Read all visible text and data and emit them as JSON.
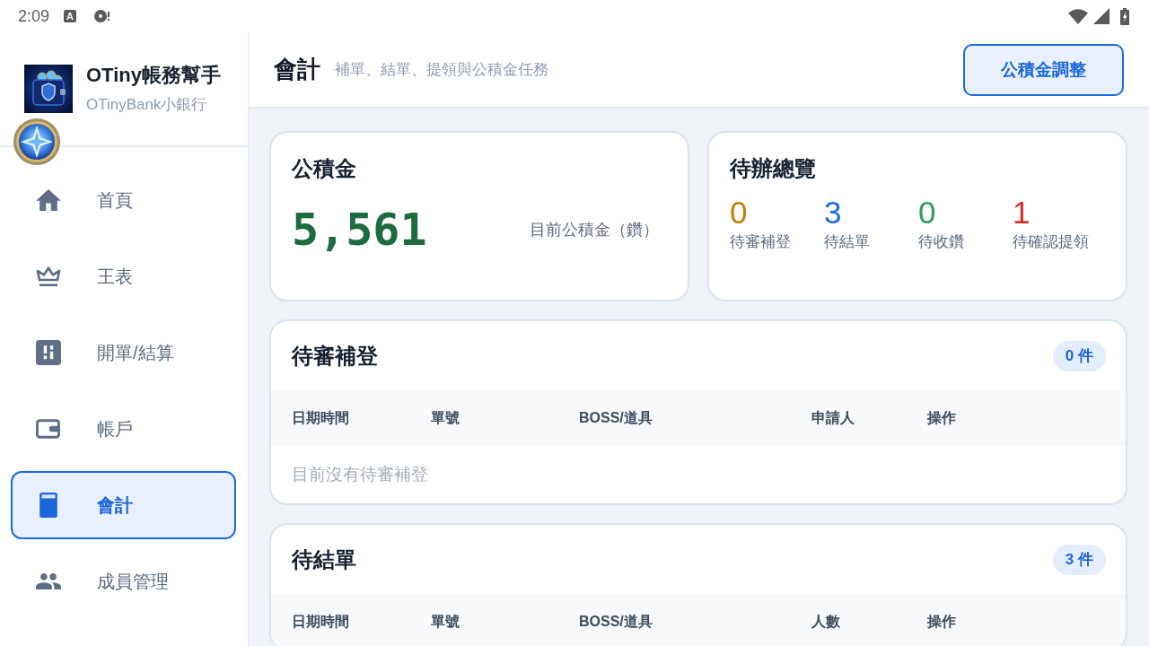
{
  "status_bar": {
    "time": "2:09",
    "app_badge": "A"
  },
  "sidebar": {
    "app_title": "OTiny帳務幫手",
    "app_subtitle": "OTinyBank小銀行",
    "items": [
      {
        "kind": "home",
        "label": "首頁",
        "selected": false
      },
      {
        "kind": "crown",
        "label": "王表",
        "selected": false
      },
      {
        "kind": "orders",
        "label": "開單/結算",
        "selected": false
      },
      {
        "kind": "wallet",
        "label": "帳戶",
        "selected": false
      },
      {
        "kind": "ledger",
        "label": "會計",
        "selected": true
      },
      {
        "kind": "members",
        "label": "成員管理",
        "selected": false
      }
    ]
  },
  "header": {
    "title": "會計",
    "subtitle": "補單、結單、提領與公積金任務",
    "action_button": "公積金調整"
  },
  "fund_card": {
    "title": "公積金",
    "amount": "5,561",
    "caption": "目前公積金（鑽）"
  },
  "overview": {
    "title": "待辦總覽",
    "stats": [
      {
        "value": "0",
        "label": "待審補登",
        "color": "#c47f0a"
      },
      {
        "value": "3",
        "label": "待結單",
        "color": "#1a6ae0"
      },
      {
        "value": "0",
        "label": "待收鑽",
        "color": "#2f9e5c"
      },
      {
        "value": "1",
        "label": "待確認提領",
        "color": "#d3302a"
      }
    ]
  },
  "sections": [
    {
      "title": "待審補登",
      "badge": "0 件",
      "columns": [
        "日期時間",
        "單號",
        "BOSS/道具",
        "申請人",
        "操作"
      ],
      "empty_text": "目前沒有待審補登"
    },
    {
      "title": "待結單",
      "badge": "3 件",
      "columns": [
        "日期時間",
        "單號",
        "BOSS/道具",
        "人數",
        "操作"
      ]
    }
  ]
}
